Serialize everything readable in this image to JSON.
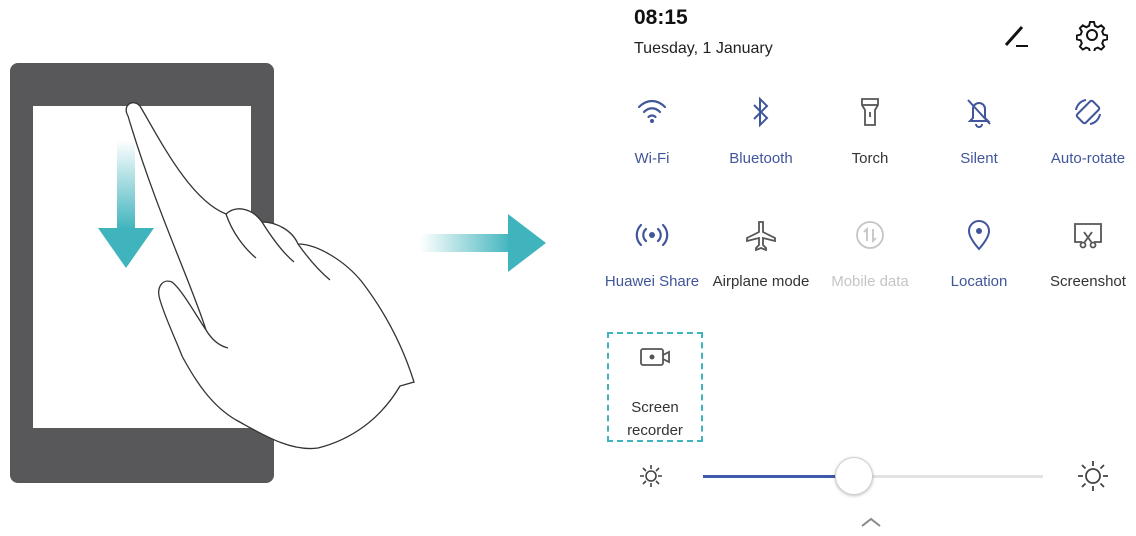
{
  "status": {
    "time": "08:15",
    "date": "Tuesday, 1 January"
  },
  "header_icons": [
    "edit-icon",
    "settings-gear-icon"
  ],
  "tiles": [
    {
      "label": "Wi-Fi",
      "icon": "wifi-icon",
      "state": "on"
    },
    {
      "label": "Bluetooth",
      "icon": "bluetooth-icon",
      "state": "on"
    },
    {
      "label": "Torch",
      "icon": "torch-icon",
      "state": "off"
    },
    {
      "label": "Silent",
      "icon": "bell-muted-icon",
      "state": "on"
    },
    {
      "label": "Auto-rotate",
      "icon": "auto-rotate-icon",
      "state": "on"
    },
    {
      "label": "Huawei Share",
      "icon": "huawei-share-icon",
      "state": "on"
    },
    {
      "label": "Airplane mode",
      "icon": "airplane-icon",
      "state": "off"
    },
    {
      "label": "Mobile data",
      "icon": "mobile-data-icon",
      "state": "disabled"
    },
    {
      "label": "Location",
      "icon": "location-pin-icon",
      "state": "on"
    },
    {
      "label": "Screenshot",
      "icon": "screenshot-icon",
      "state": "off"
    }
  ],
  "recorder": {
    "line1": "Screen",
    "line2": "recorder",
    "icon": "screen-recorder-icon"
  },
  "brightness": {
    "level": 0.44,
    "min_icon": "brightness-low-icon",
    "max_icon": "brightness-high-icon"
  },
  "collapse_icon": "chevron-up-icon",
  "colors": {
    "active": "#41569a",
    "inactive": "#333333",
    "disabled": "#c5c5c5",
    "accent_teal": "#3fb4bd",
    "device_frame": "#58585a"
  }
}
